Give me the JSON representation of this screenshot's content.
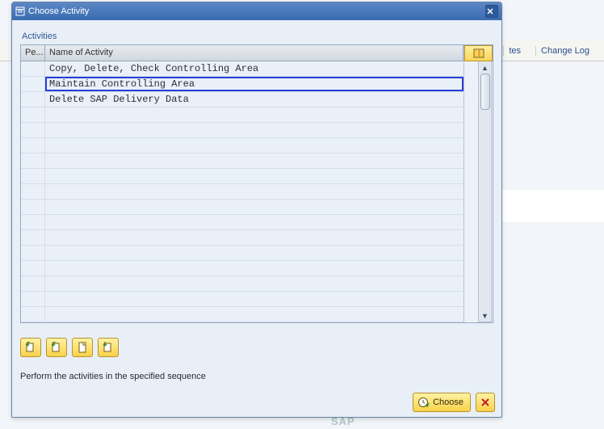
{
  "bg": {
    "tes": "tes",
    "change_log": "Change Log"
  },
  "dialog": {
    "title": "Choose Activity",
    "section": "Activities",
    "columns": {
      "pe": "Pe...",
      "name": "Name of Activity"
    },
    "rows": [
      {
        "pe": "",
        "name": "Copy, Delete, Check Controlling Area",
        "hl": false
      },
      {
        "pe": "",
        "name": "Maintain Controlling Area",
        "hl": true
      },
      {
        "pe": "",
        "name": "Delete SAP Delivery Data",
        "hl": false
      }
    ],
    "instruction": "Perform the activities in the specified sequence",
    "choose_label": "Choose"
  }
}
